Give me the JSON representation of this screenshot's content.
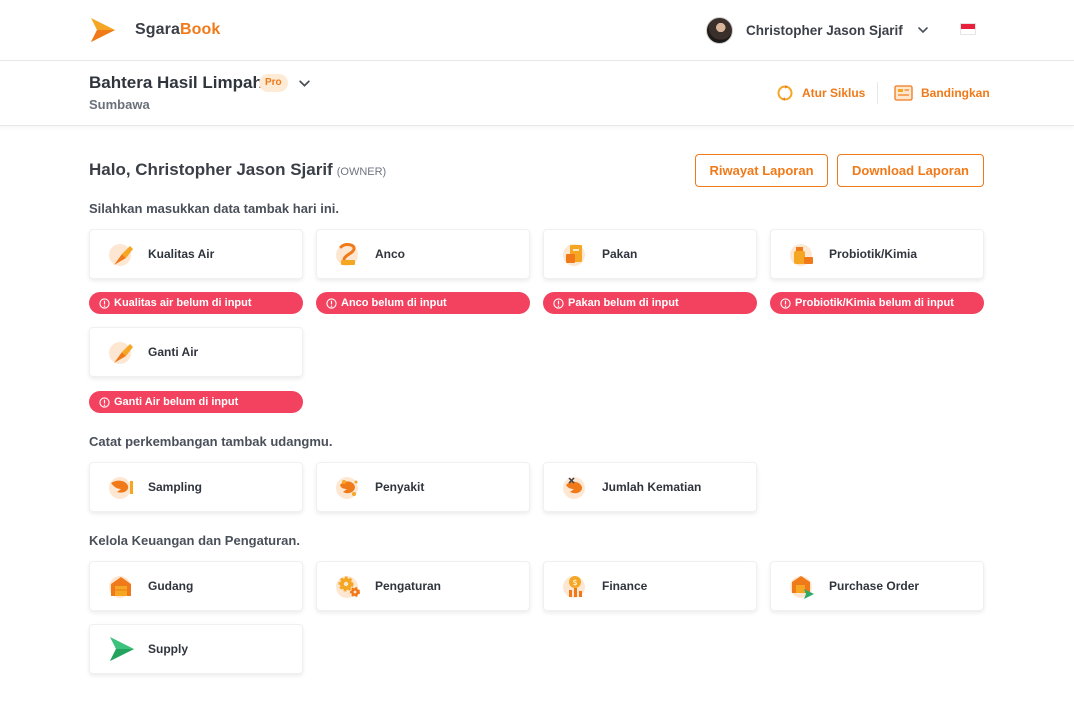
{
  "app": {
    "brand_part1": "Sgara",
    "brand_part2": "Book",
    "accent_color": "#f07a1a",
    "alert_color": "#f2425f"
  },
  "user": {
    "name": "Christopher Jason Sjarif"
  },
  "farm": {
    "name": "Bahtera Hasil Limpah",
    "badge": "Pro",
    "location": "Sumbawa",
    "actions": {
      "siklus": "Atur Siklus",
      "bandingkan": "Bandingkan"
    }
  },
  "greeting": {
    "text": "Halo, Christopher Jason Sjarif",
    "role": "(OWNER)"
  },
  "buttons": {
    "riwayat": "Riwayat Laporan",
    "download": "Download Laporan"
  },
  "sections": {
    "input_title": "Silahkan masukkan data tambak hari ini.",
    "progress_title": "Catat perkembangan tambak udangmu.",
    "finance_title": "Kelola Keuangan dan Pengaturan."
  },
  "input_cards": [
    {
      "label": "Kualitas Air",
      "icon": "water-quality-icon",
      "alert": "Kualitas air belum di input"
    },
    {
      "label": "Anco",
      "icon": "anco-icon",
      "alert": "Anco belum di input"
    },
    {
      "label": "Pakan",
      "icon": "feed-icon",
      "alert": "Pakan belum di input"
    },
    {
      "label": "Probiotik/Kimia",
      "icon": "probiotic-icon",
      "alert": "Probiotik/Kimia belum di input"
    },
    {
      "label": "Ganti Air",
      "icon": "water-change-icon",
      "alert": "Ganti Air belum di input"
    }
  ],
  "progress_cards": [
    {
      "label": "Sampling",
      "icon": "sampling-icon"
    },
    {
      "label": "Penyakit",
      "icon": "disease-icon"
    },
    {
      "label": "Jumlah Kematian",
      "icon": "mortality-icon"
    }
  ],
  "finance_cards": [
    {
      "label": "Gudang",
      "icon": "warehouse-icon"
    },
    {
      "label": "Pengaturan",
      "icon": "settings-icon"
    },
    {
      "label": "Finance",
      "icon": "finance-icon"
    },
    {
      "label": "Purchase Order",
      "icon": "purchase-order-icon"
    },
    {
      "label": "Supply",
      "icon": "supply-icon"
    }
  ]
}
